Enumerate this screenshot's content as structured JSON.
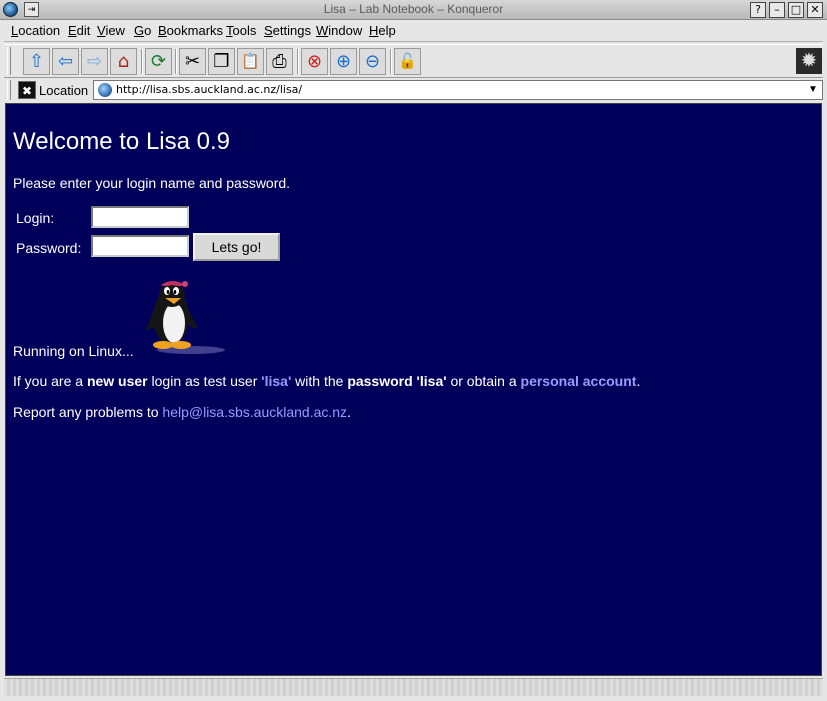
{
  "window": {
    "title": "Lisa – Lab Notebook – Konqueror",
    "sticky_glyph": "⇥",
    "buttons": {
      "help": "?",
      "minimize": "–",
      "maximize": "□",
      "close": "✕"
    }
  },
  "menu": [
    {
      "ul": "L",
      "rest": "ocation"
    },
    {
      "ul": "E",
      "rest": "dit"
    },
    {
      "ul": "V",
      "rest": "iew"
    },
    {
      "ul": "G",
      "rest": "o"
    },
    {
      "ul": "B",
      "rest": "ookmarks"
    },
    {
      "ul": "T",
      "rest": "ools"
    },
    {
      "ul": "S",
      "rest": "ettings"
    },
    {
      "ul": "W",
      "rest": "indow"
    },
    {
      "ul": "H",
      "rest": "elp"
    }
  ],
  "toolbar": {
    "icons": [
      "up-arrow-icon",
      "back-arrow-icon",
      "forward-arrow-icon",
      "home-icon",
      "reload-icon",
      "cut-icon",
      "copy-icon",
      "paste-icon",
      "print-icon",
      "stop-icon",
      "zoom-in-icon",
      "zoom-out-icon",
      "security-lock-icon",
      "settings-gear-icon"
    ],
    "glyphs": {
      "up": "⇧",
      "back": "⇦",
      "forward": "⇨",
      "home": "⌂",
      "reload": "⟳",
      "cut": "✂",
      "copy": "❐",
      "paste": "📋",
      "print": "⎙",
      "stop": "⊗",
      "zoom_in": "⊕",
      "zoom_out": "⊖",
      "lock": "🔓",
      "gear": "✹"
    }
  },
  "location": {
    "clear_glyph": "✖",
    "label": "Location",
    "url": "http://lisa.sbs.auckland.ac.nz/lisa/",
    "dropdown_glyph": "▼"
  },
  "page": {
    "background": "#00005a",
    "title": "Welcome to Lisa 0.9",
    "intro": "Please enter your login name and password.",
    "login_label": "Login:",
    "password_label": "Password:",
    "login_value": "",
    "password_value": "",
    "submit_label": "Lets go!",
    "running": "Running on Linux...",
    "newuser": {
      "p1": "If you are a ",
      "b1": "new user",
      "p2": " login as test user ",
      "l1": "'lisa'",
      "p3": " with the ",
      "b2": "password 'lisa'",
      "p4": " or obtain a ",
      "l2": "personal account",
      "p5": "."
    },
    "report": {
      "p1": "Report any problems to ",
      "email": "help@lisa.sbs.auckland.ac.nz",
      "p2": "."
    },
    "link_color": "#9a9aff"
  }
}
